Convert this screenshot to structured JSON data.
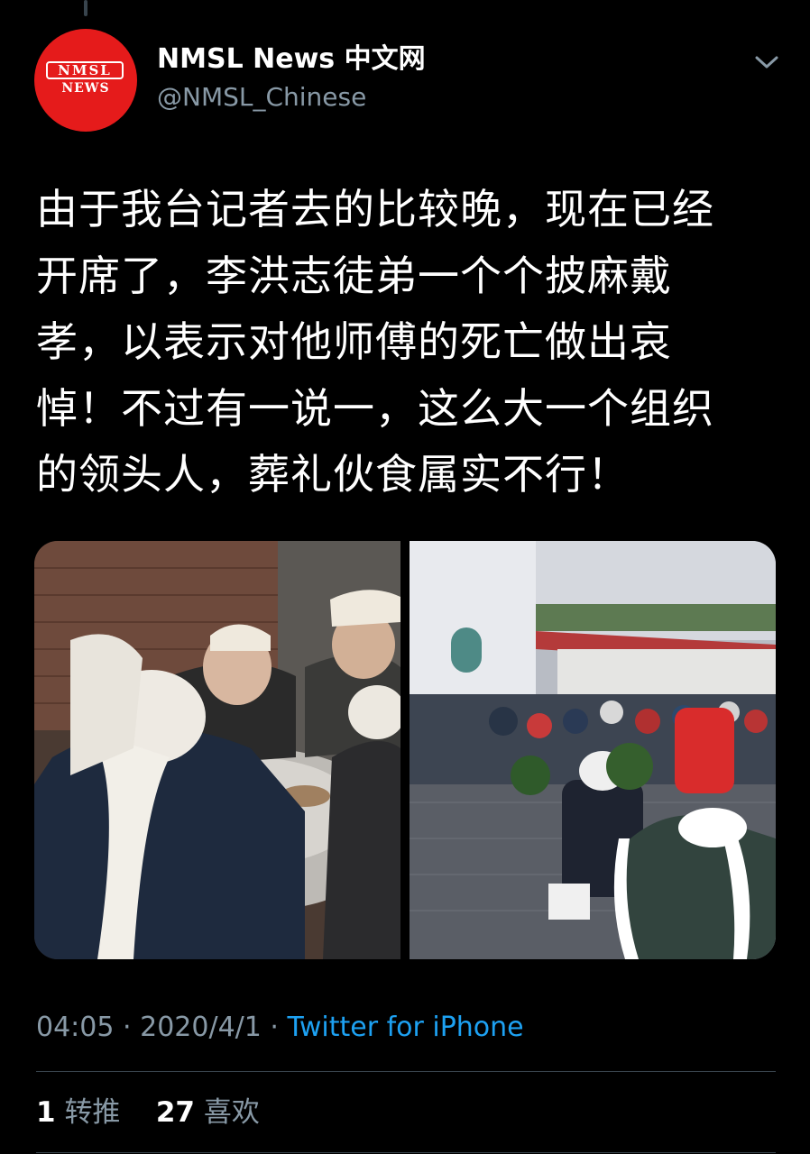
{
  "tweet": {
    "author": {
      "display_name": "NMSL News 中文网",
      "handle": "@NMSL_Chinese",
      "avatar_logo_top": "NMSL",
      "avatar_logo_bottom": "NEWS",
      "avatar_color": "#e51b1b"
    },
    "text_lines": [
      "由于我台记者去的比较晚，现在已经",
      "开席了，李洪志徒弟一个个披麻戴",
      "孝，以表示对他师傅的死亡做出哀",
      "悼！不过有一说一，这么大一个组织",
      "的领头人，葬礼伙食属实不行！"
    ],
    "time": "04:05",
    "separator": "·",
    "date": "2020/4/1",
    "source": "Twitter for iPhone",
    "retweets_count": "1",
    "retweets_label": "转推",
    "likes_count": "27",
    "likes_label": "喜欢"
  },
  "icons": {
    "menu": "chevron-down-icon"
  },
  "colors": {
    "background": "#000000",
    "secondary_text": "#8899a6",
    "link": "#1da1f2",
    "divider": "#38444d"
  }
}
